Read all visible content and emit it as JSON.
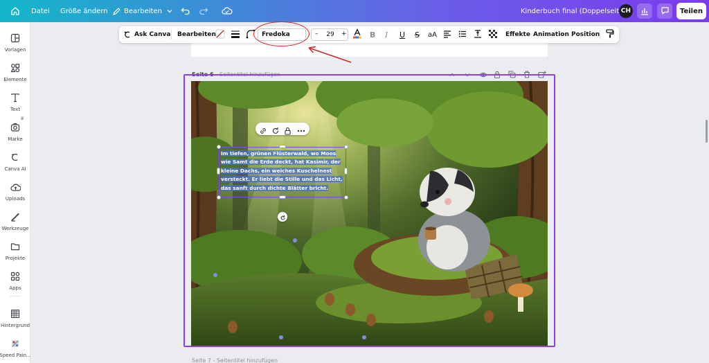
{
  "topbar": {
    "home_icon": "home-icon",
    "file_label": "Datei",
    "resize_label": "Größe ändern",
    "edit_label": "Bearbeiten",
    "doc_title": "Kinderbuch final (Doppelseitig)",
    "avatar_initials": "CH",
    "share_label": "Teilen"
  },
  "sidebar": {
    "items": [
      {
        "label": "Vorlagen",
        "icon": "templates-icon"
      },
      {
        "label": "Elemente",
        "icon": "elements-icon"
      },
      {
        "label": "Text",
        "icon": "text-icon"
      },
      {
        "label": "Marke",
        "icon": "brand-icon"
      },
      {
        "label": "Canva AI",
        "icon": "canva-ai-icon"
      },
      {
        "label": "Uploads",
        "icon": "uploads-icon"
      },
      {
        "label": "Werkzeuge",
        "icon": "tools-icon"
      },
      {
        "label": "Projekte",
        "icon": "projects-icon"
      },
      {
        "label": "Apps",
        "icon": "apps-icon"
      },
      {
        "label": "Hintergrund",
        "icon": "background-icon"
      },
      {
        "label": "Speed Pain...",
        "icon": "speed-paint-icon"
      }
    ]
  },
  "text_toolbar": {
    "ask_canva": "Ask Canva",
    "edit": "Bearbeiten",
    "font": "Fredoka",
    "size_minus": "–",
    "size": "29",
    "size_plus": "+",
    "bold": "B",
    "italic": "I",
    "underline": "U",
    "strike": "S",
    "case": "aA",
    "effects": "Effekte",
    "animation": "Animation",
    "position": "Position"
  },
  "page": {
    "header_number": "Seite 6",
    "header_subtitle": "- Seitentitel hinzufügen",
    "next_header": "Seite 7 - Seitentitel hinzufügen"
  },
  "story_text": {
    "lines": [
      "Im tiefen, grünen Flüsterwald, wo Moos",
      "wie Samt die Erde deckt, hat Kasimir, der",
      "kleine Dachs, ein weiches Kuschelnest",
      "versteckt. Er liebt die Stille und das Licht,",
      "das sanft durch dichte Blätter bricht."
    ]
  },
  "colors": {
    "accent": "#8b3dff",
    "annotation": "#d32626"
  }
}
